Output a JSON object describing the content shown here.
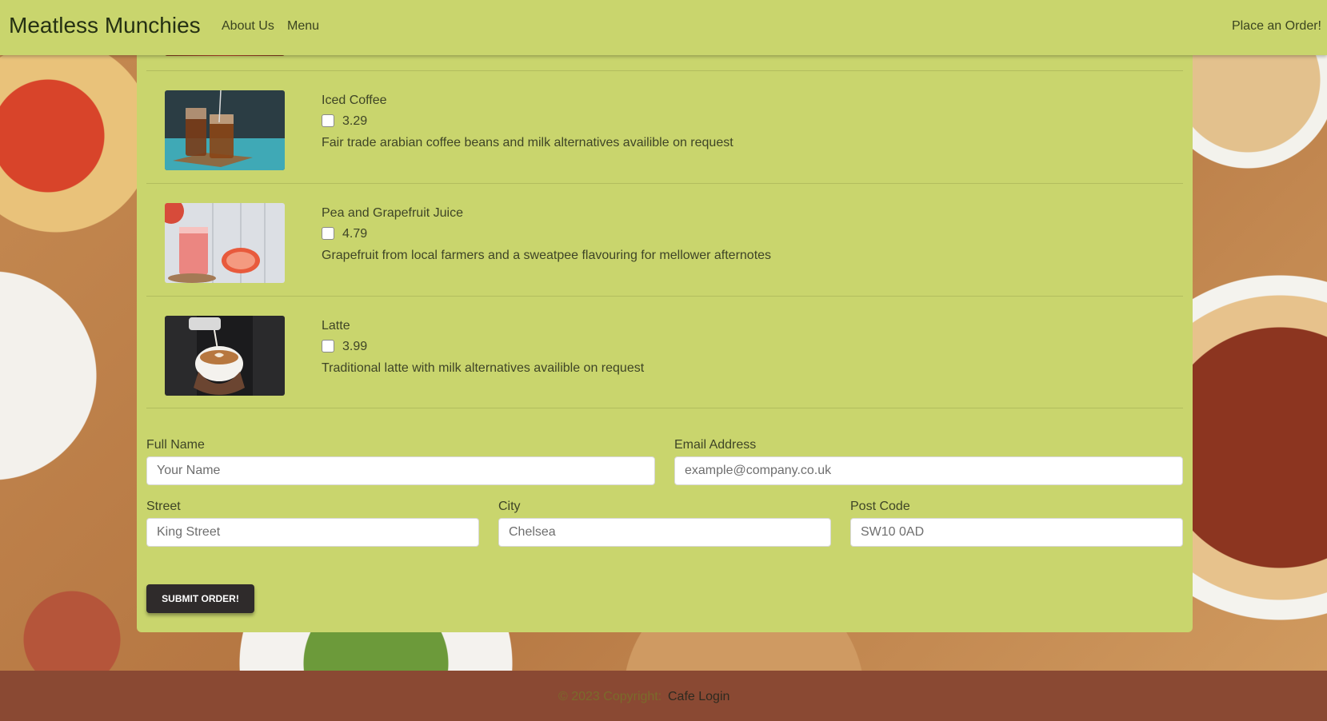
{
  "navbar": {
    "brand": "Meatless Munchies",
    "links": [
      "About Us",
      "Menu"
    ],
    "order_link": "Place an Order!"
  },
  "menu_items": [
    {
      "name": "Iced Coffee",
      "price": "3.29",
      "description": "Fair trade arabian coffee beans and milk alternatives availible on request",
      "image": "iced-coffee-image"
    },
    {
      "name": "Pea and Grapefruit Juice",
      "price": "4.79",
      "description": "Grapefruit from local farmers and a sweatpee flavouring for mellower afternotes",
      "image": "grapefruit-juice-image"
    },
    {
      "name": "Latte",
      "price": "3.99",
      "description": "Traditional latte with milk alternatives availible on request",
      "image": "latte-image"
    }
  ],
  "form": {
    "full_name": {
      "label": "Full Name",
      "placeholder": "Your Name"
    },
    "email": {
      "label": "Email Address",
      "placeholder": "example@company.co.uk"
    },
    "street": {
      "label": "Street",
      "placeholder": "King Street"
    },
    "city": {
      "label": "City",
      "placeholder": "Chelsea"
    },
    "post_code": {
      "label": "Post Code",
      "placeholder": "SW10 0AD"
    },
    "submit_label": "SUBMIT ORDER!"
  },
  "footer": {
    "copyright": "© 2023 Copyright:",
    "login_link": "Cafe Login"
  },
  "colors": {
    "navbar_bg": "#c9d56d",
    "footer_bg": "#8a4933",
    "button_bg": "#2f2b2b"
  }
}
